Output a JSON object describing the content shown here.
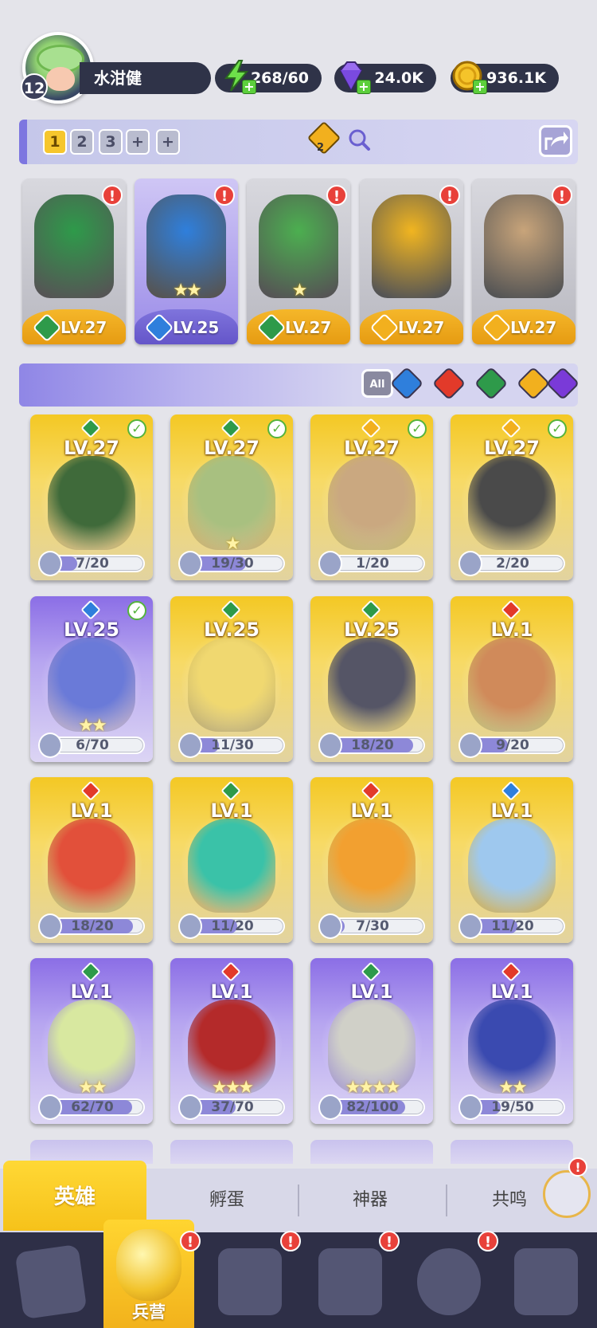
{
  "player": {
    "level": "12",
    "name": "水泔健"
  },
  "resources": {
    "energy": "268/60",
    "gems": "24.0K",
    "gold": "936.1K"
  },
  "team": {
    "slots": [
      "1",
      "2",
      "3",
      "+",
      "+"
    ],
    "active_slot": 0,
    "counter_badge": "2",
    "members": [
      {
        "level": "LV.27",
        "element": "wind",
        "color": "#2e9a4a",
        "stars": "",
        "alert": "!"
      },
      {
        "level": "LV.25",
        "element": "water",
        "color": "#2f7fdc",
        "stars": "★★",
        "alert": "!"
      },
      {
        "level": "LV.27",
        "element": "wind",
        "color": "#4caf50",
        "stars": "★",
        "alert": "!"
      },
      {
        "level": "LV.27",
        "element": "light",
        "color": "#f1b520",
        "stars": "",
        "alert": "!"
      },
      {
        "level": "LV.27",
        "element": "light",
        "color": "#c8a47a",
        "stars": "",
        "alert": "!"
      }
    ]
  },
  "filters": {
    "all_label": "All",
    "elements": [
      "water",
      "fire",
      "wind",
      "light",
      "dark"
    ]
  },
  "heroes": [
    {
      "level": "LV.27",
      "element": "wind",
      "progress": "7/20",
      "fraction": 0.35,
      "owned": true,
      "char_color": "#3f6a3a",
      "stars": ""
    },
    {
      "level": "LV.27",
      "element": "wind",
      "progress": "19/30",
      "fraction": 0.63,
      "owned": true,
      "char_color": "#a8c080",
      "stars": "★"
    },
    {
      "level": "LV.27",
      "element": "light",
      "progress": "1/20",
      "fraction": 0.05,
      "owned": true,
      "char_color": "#caa880",
      "stars": ""
    },
    {
      "level": "LV.27",
      "element": "light",
      "progress": "2/20",
      "fraction": 0.1,
      "owned": true,
      "char_color": "#4a4a4a",
      "stars": ""
    },
    {
      "level": "LV.25",
      "element": "water",
      "progress": "6/70",
      "fraction": 0.09,
      "owned": true,
      "char_color": "#6a7ad8",
      "stars": "★★"
    },
    {
      "level": "LV.25",
      "element": "wind",
      "progress": "11/30",
      "fraction": 0.37,
      "owned": false,
      "char_color": "#f0d870",
      "stars": ""
    },
    {
      "level": "LV.25",
      "element": "wind",
      "progress": "18/20",
      "fraction": 0.9,
      "owned": false,
      "char_color": "#555566",
      "stars": ""
    },
    {
      "level": "LV.1",
      "element": "fire",
      "progress": "9/20",
      "fraction": 0.45,
      "owned": false,
      "char_color": "#d08a5a",
      "stars": ""
    },
    {
      "level": "LV.1",
      "element": "fire",
      "progress": "18/20",
      "fraction": 0.9,
      "owned": false,
      "char_color": "#e2503a",
      "stars": ""
    },
    {
      "level": "LV.1",
      "element": "wind",
      "progress": "11/20",
      "fraction": 0.55,
      "owned": false,
      "char_color": "#3ac2a8",
      "stars": ""
    },
    {
      "level": "LV.1",
      "element": "fire",
      "progress": "7/30",
      "fraction": 0.23,
      "owned": false,
      "char_color": "#f2a030",
      "stars": ""
    },
    {
      "level": "LV.1",
      "element": "water",
      "progress": "11/20",
      "fraction": 0.55,
      "owned": false,
      "char_color": "#9ec8ee",
      "stars": ""
    },
    {
      "level": "LV.1",
      "element": "wind",
      "progress": "62/70",
      "fraction": 0.89,
      "owned": false,
      "char_color": "#d8e8a0",
      "stars": "★★"
    },
    {
      "level": "LV.1",
      "element": "fire",
      "progress": "37/70",
      "fraction": 0.53,
      "owned": false,
      "char_color": "#b42a2a",
      "stars": "★★★"
    },
    {
      "level": "LV.1",
      "element": "wind",
      "progress": "82/100",
      "fraction": 0.82,
      "owned": false,
      "char_color": "#d0d0c8",
      "stars": "★★★★"
    },
    {
      "level": "LV.1",
      "element": "fire",
      "progress": "19/50",
      "fraction": 0.38,
      "owned": false,
      "char_color": "#3a4ab0",
      "stars": "★★"
    }
  ],
  "tabs": [
    "英雄",
    "孵蛋",
    "神器",
    "共鸣"
  ],
  "nav": {
    "active_label": "兵营",
    "alerts": [
      "!",
      "!",
      "!",
      "!"
    ],
    "fab_alert": "!"
  },
  "element_colors": {
    "water": "#2f7fdc",
    "fire": "#e23a2a",
    "wind": "#2e9a4a",
    "light": "#f2b01e",
    "dark": "#7a3ad8"
  }
}
